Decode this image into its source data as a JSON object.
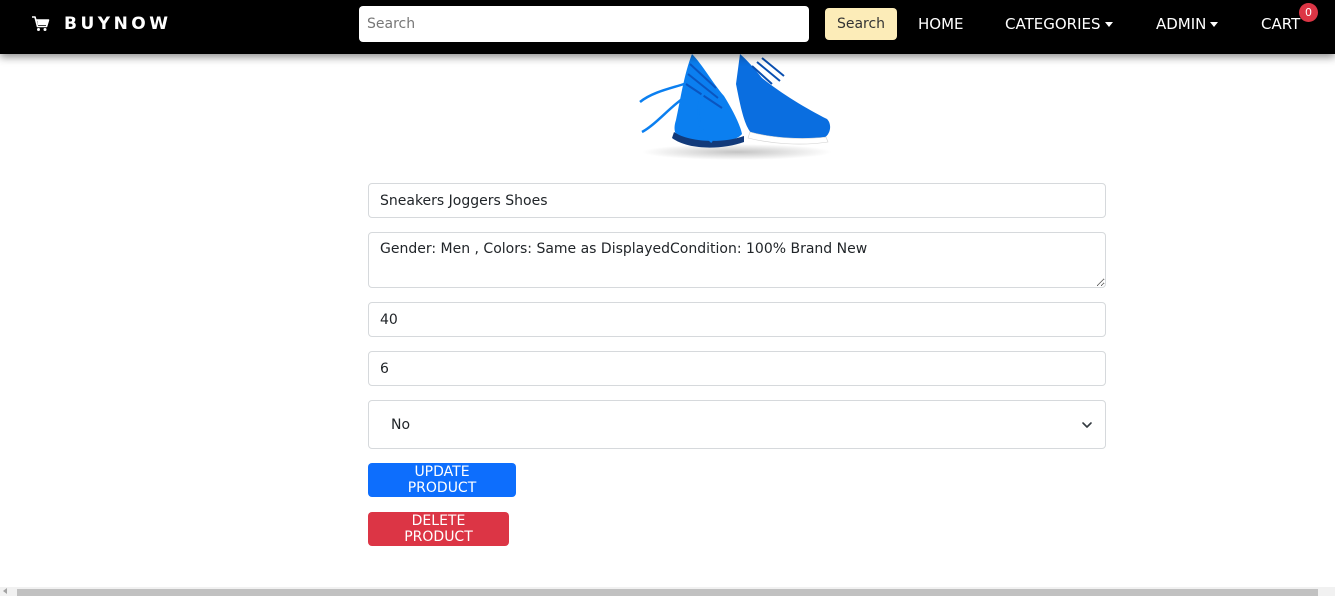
{
  "navbar": {
    "brand": "BUYNOW",
    "brand_icon": "cart-icon",
    "search_placeholder": "Search",
    "search_button": "Search",
    "links": {
      "home": "HOME",
      "categories": "CATEGORIES",
      "admin": "ADMIN",
      "cart": "CART"
    },
    "cart_count": "0",
    "colors": {
      "background": "#000000",
      "search_button": "#fcecb8",
      "badge": "#dc3545"
    }
  },
  "product": {
    "image": "sneakers-image",
    "name": "Sneakers Joggers Shoes",
    "description": "Gender: Men , Colors: Same as DisplayedCondition: 100% Brand New",
    "price": "40",
    "quantity": "6",
    "shipping_selected": "No"
  },
  "actions": {
    "update": "UPDATE PRODUCT",
    "delete": "DELETE PRODUCT",
    "colors": {
      "update": "#0d6efd",
      "delete": "#dc3545"
    }
  }
}
